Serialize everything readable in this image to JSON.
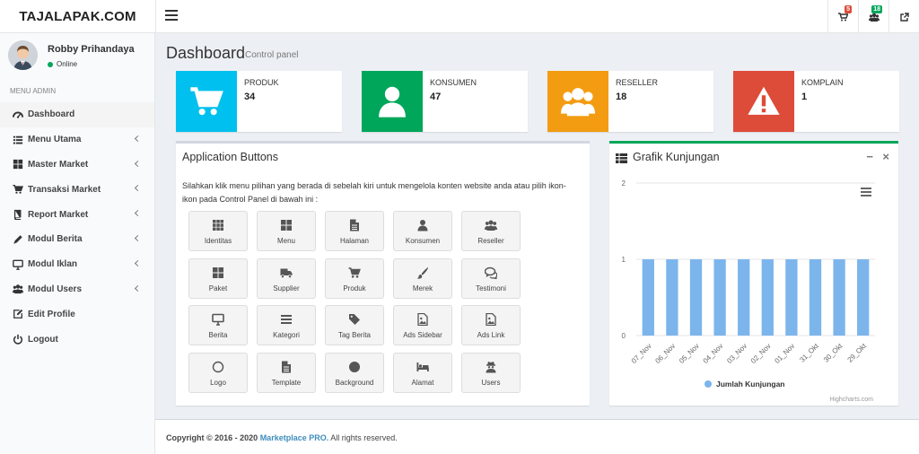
{
  "brand": {
    "logo_text": "TAJALAPAK.COM"
  },
  "topbar": {
    "menu_toggle_icon": "hamburger-icon",
    "icons": [
      {
        "name": "cart-notification",
        "icon": "cart-icon",
        "badge": "5",
        "badge_color": "#dd4b39"
      },
      {
        "name": "users-notification",
        "icon": "users-icon",
        "badge": "18",
        "badge_color": "#00a65a"
      },
      {
        "name": "external-link",
        "icon": "external-link-icon",
        "badge": "",
        "badge_color": ""
      }
    ]
  },
  "user": {
    "name": "Robby Prihandaya",
    "status": "Online"
  },
  "sidebar": {
    "header": "MENU ADMIN",
    "items": [
      {
        "label": "Dashboard",
        "icon": "dashboard-icon",
        "active": true,
        "has_children": false
      },
      {
        "label": "Menu Utama",
        "icon": "list-icon",
        "active": false,
        "has_children": true
      },
      {
        "label": "Master Market",
        "icon": "th-large-icon",
        "active": false,
        "has_children": true
      },
      {
        "label": "Transaksi Market",
        "icon": "cart-icon",
        "active": false,
        "has_children": true
      },
      {
        "label": "Report Market",
        "icon": "book-icon",
        "active": false,
        "has_children": true
      },
      {
        "label": "Modul Berita",
        "icon": "pencil-icon",
        "active": false,
        "has_children": true
      },
      {
        "label": "Modul Iklan",
        "icon": "desktop-icon",
        "active": false,
        "has_children": true
      },
      {
        "label": "Modul Users",
        "icon": "users-icon",
        "active": false,
        "has_children": true
      },
      {
        "label": "Edit Profile",
        "icon": "edit-icon",
        "active": false,
        "has_children": false
      },
      {
        "label": "Logout",
        "icon": "power-icon",
        "active": false,
        "has_children": false
      }
    ]
  },
  "page": {
    "title": "Dashboard",
    "subtitle": "Control panel"
  },
  "infoboxes": [
    {
      "label": "PRODUK",
      "value": "34",
      "color": "#00c0ef",
      "icon": "cart-icon"
    },
    {
      "label": "KONSUMEN",
      "value": "47",
      "color": "#00a65a",
      "icon": "user-icon"
    },
    {
      "label": "RESELLER",
      "value": "18",
      "color": "#f39c12",
      "icon": "users-icon"
    },
    {
      "label": "KOMPLAIN",
      "value": "1",
      "color": "#dd4b39",
      "icon": "warning-icon"
    }
  ],
  "app_buttons": {
    "title": "Application Buttons",
    "description": "Silahkan klik menu pilihan yang berada di sebelah kiri untuk mengelola konten website anda atau pilih ikon-ikon pada Control Panel di bawah ini :",
    "buttons": [
      {
        "label": "Identitas",
        "icon": "th-icon"
      },
      {
        "label": "Menu",
        "icon": "th-large-icon"
      },
      {
        "label": "Halaman",
        "icon": "file-icon"
      },
      {
        "label": "Konsumen",
        "icon": "user-icon"
      },
      {
        "label": "Reseller",
        "icon": "users-icon"
      },
      {
        "label": "Paket",
        "icon": "th-large-icon"
      },
      {
        "label": "Supplier",
        "icon": "truck-icon"
      },
      {
        "label": "Produk",
        "icon": "cart-icon"
      },
      {
        "label": "Merek",
        "icon": "brush-icon"
      },
      {
        "label": "Testimoni",
        "icon": "comments-icon"
      },
      {
        "label": "Berita",
        "icon": "desktop-icon"
      },
      {
        "label": "Kategori",
        "icon": "bars-icon"
      },
      {
        "label": "Tag Berita",
        "icon": "tag-icon"
      },
      {
        "label": "Ads Sidebar",
        "icon": "image-icon"
      },
      {
        "label": "Ads Link",
        "icon": "image-icon"
      },
      {
        "label": "Logo",
        "icon": "circle-outline-icon"
      },
      {
        "label": "Template",
        "icon": "file-icon"
      },
      {
        "label": "Background",
        "icon": "circle-icon"
      },
      {
        "label": "Alamat",
        "icon": "bed-icon"
      },
      {
        "label": "Users",
        "icon": "user-secret-icon"
      }
    ]
  },
  "chart_box": {
    "title": "Grafik Kunjungan",
    "minimize_label": "−",
    "close_label": "×",
    "credits": "Highcharts.com"
  },
  "chart_data": {
    "type": "bar",
    "categories": [
      "07_Nov",
      "06_Nov",
      "05_Nov",
      "04_Nov",
      "03_Nov",
      "02_Nov",
      "01_Nov",
      "31_Okt",
      "30_Okt",
      "29_Okt"
    ],
    "series": [
      {
        "name": "Jumlah Kunjungan",
        "values": [
          1,
          1,
          1,
          1,
          1,
          1,
          1,
          1,
          1,
          1
        ],
        "color": "#7cb5ec"
      }
    ],
    "yticks": [
      0,
      1,
      2
    ],
    "ylim": [
      0,
      2
    ],
    "grid": true,
    "legend": "bottom-center"
  },
  "footer": {
    "prefix": "Copyright © 2016 - 2020",
    "link": "Marketplace PRO.",
    "suffix": "All rights reserved."
  }
}
